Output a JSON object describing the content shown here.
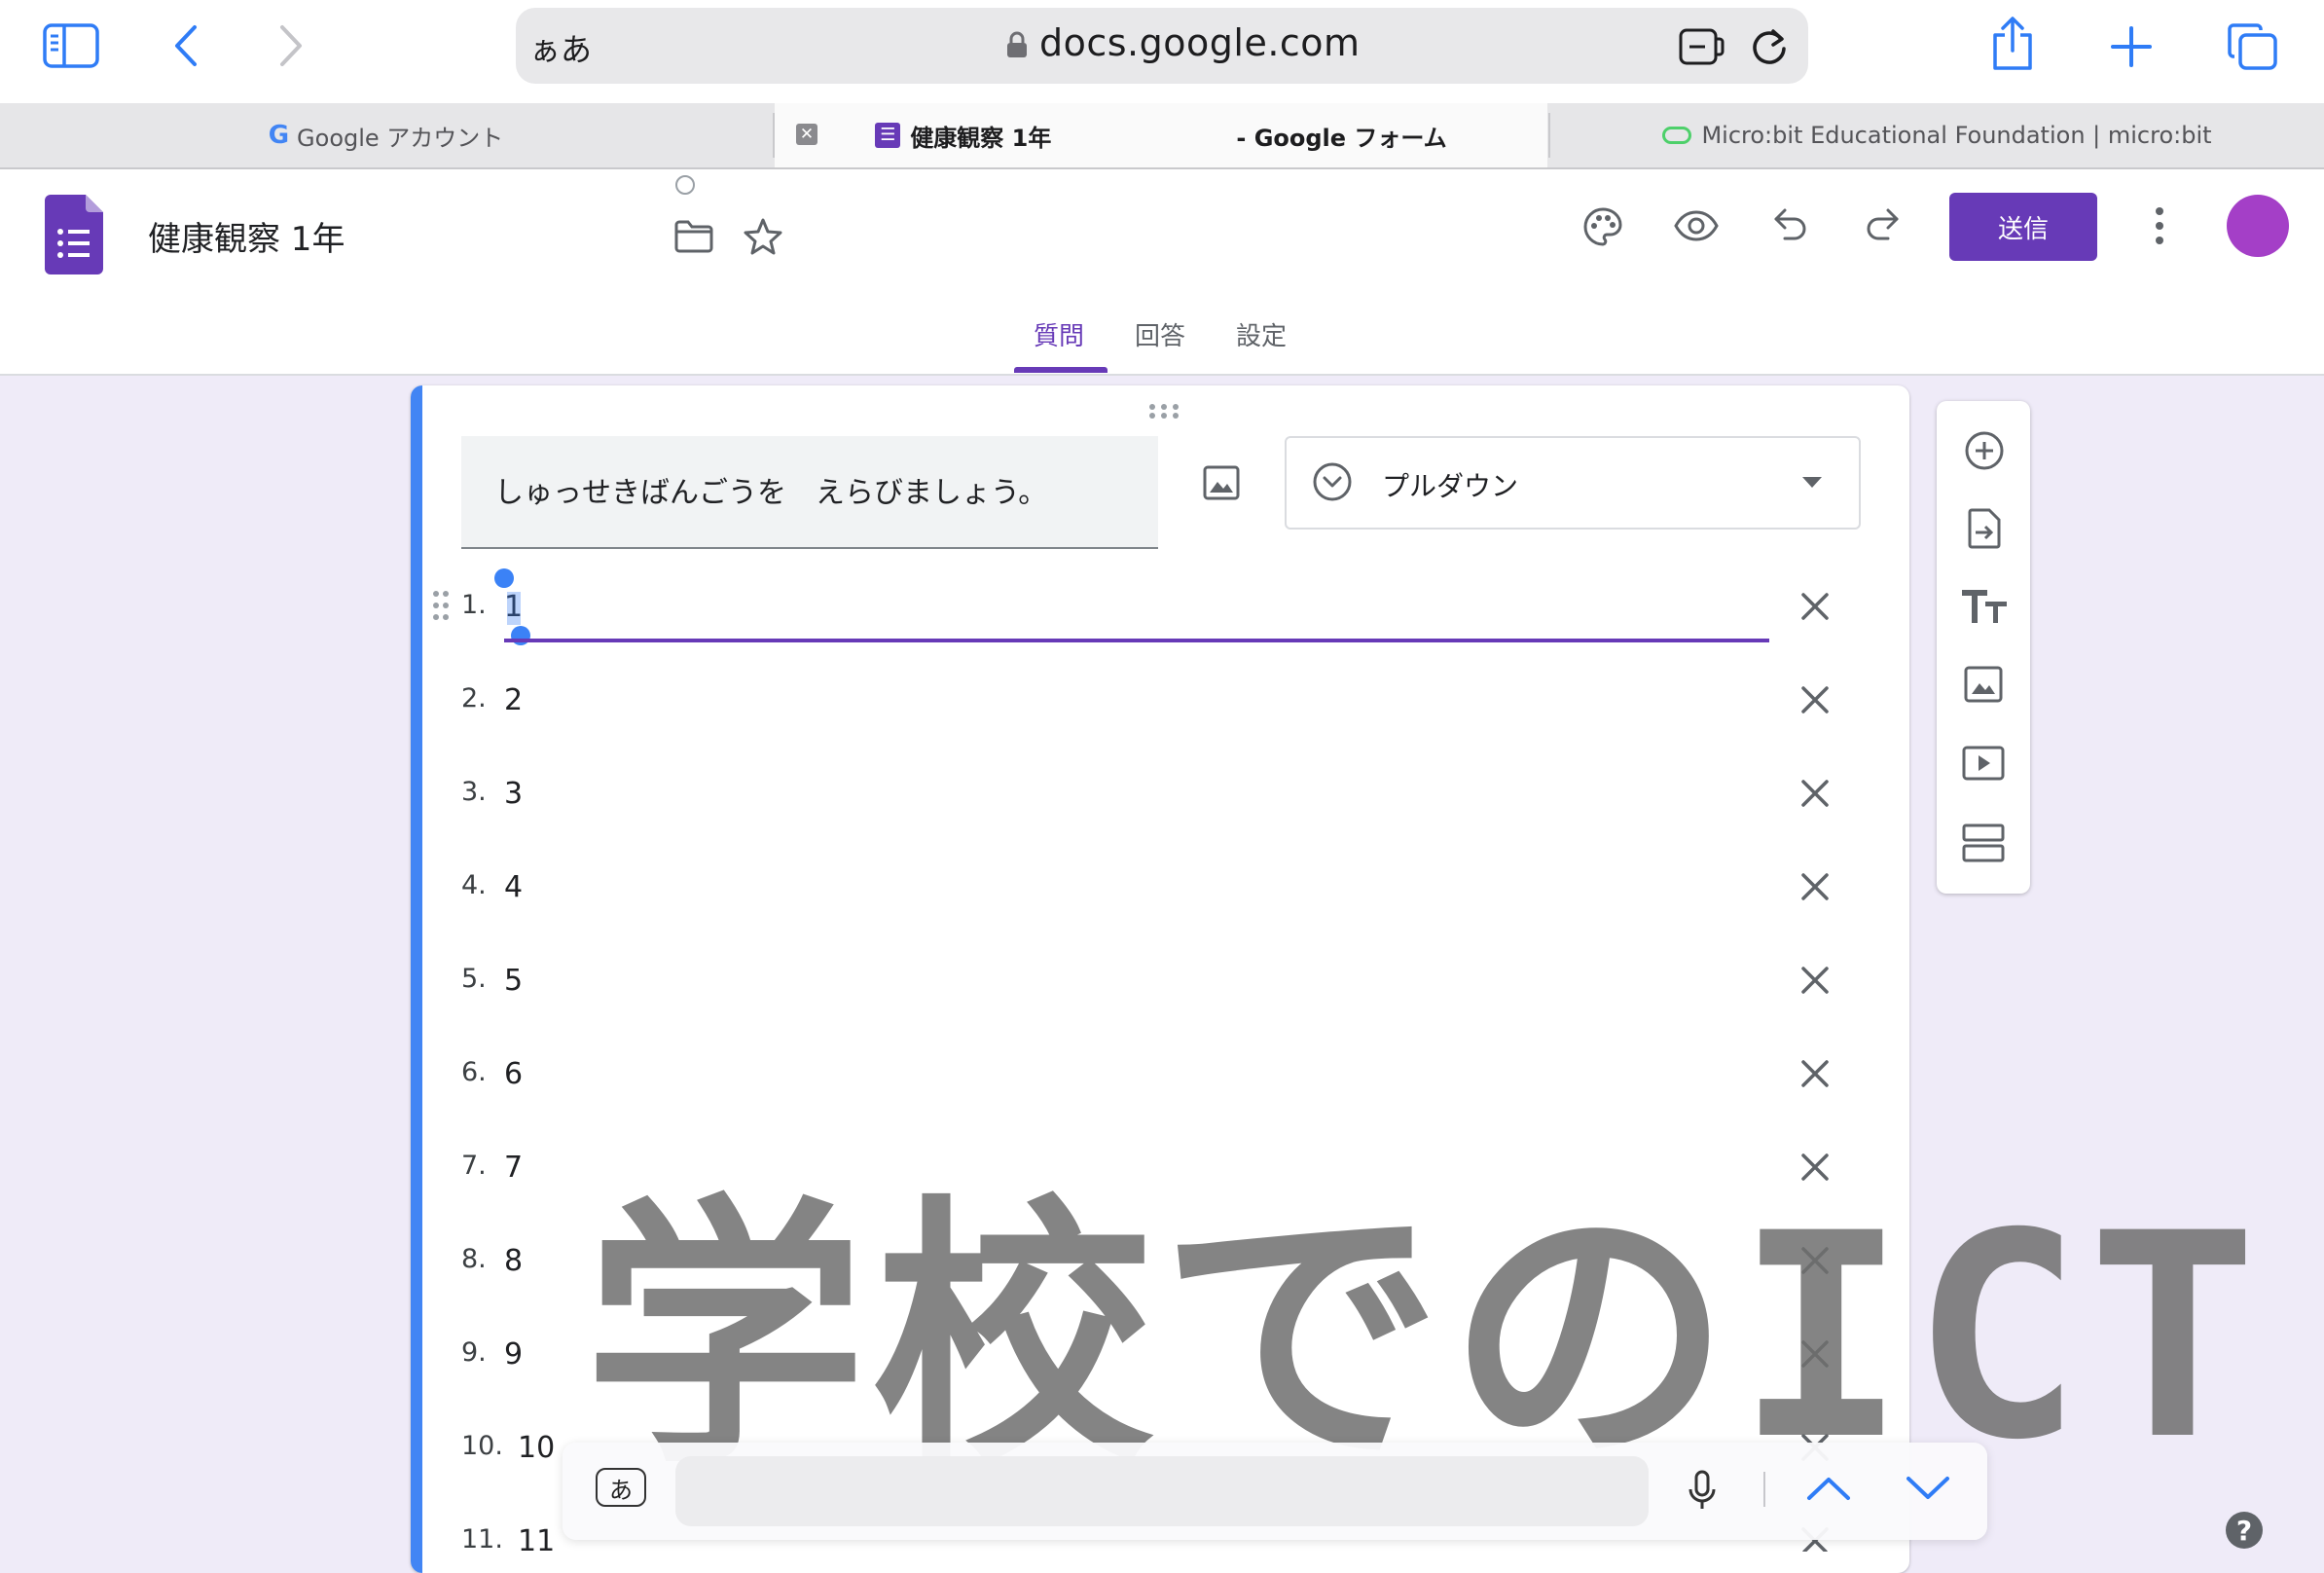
{
  "browser": {
    "aa_label": "ぁあ",
    "url": "docs.google.com",
    "tabs": [
      {
        "label": "Google アカウント"
      },
      {
        "label_a": "健康観察 1年",
        "label_b": "- Google フォーム"
      },
      {
        "label": "Micro:bit Educational Foundation | micro:bit"
      }
    ]
  },
  "form": {
    "title": "健康観察 1年",
    "send_label": "送信",
    "nav_tabs": [
      {
        "label": "質問"
      },
      {
        "label": "回答"
      },
      {
        "label": "設定"
      }
    ],
    "accent_color": "#673ab7"
  },
  "question": {
    "text": "しゅっせきばんごうを　えらびましょう。",
    "type_label": "プルダウン",
    "options": [
      {
        "num": "1.",
        "value": "1"
      },
      {
        "num": "2.",
        "value": "2"
      },
      {
        "num": "3.",
        "value": "3"
      },
      {
        "num": "4.",
        "value": "4"
      },
      {
        "num": "5.",
        "value": "5"
      },
      {
        "num": "6.",
        "value": "6"
      },
      {
        "num": "7.",
        "value": "7"
      },
      {
        "num": "8.",
        "value": "8"
      },
      {
        "num": "9.",
        "value": "9"
      },
      {
        "num": "10.",
        "value": "10"
      },
      {
        "num": "11.",
        "value": "11"
      }
    ]
  },
  "side_toolbar": {
    "icons": [
      "add-question-icon",
      "import-questions-icon",
      "add-title-icon",
      "add-image-icon",
      "add-video-icon",
      "add-section-icon"
    ]
  },
  "keyboard": {
    "ime_key": "あ"
  },
  "watermark": "学校でのICT",
  "help": "?"
}
